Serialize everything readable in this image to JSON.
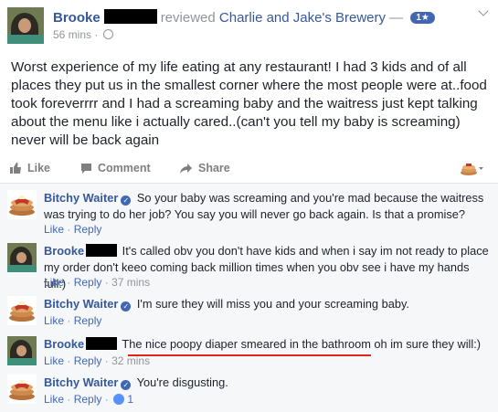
{
  "post": {
    "author": "Brooke",
    "verb": "reviewed",
    "page": "Charlie and Jake's Brewery",
    "dash": "—",
    "rating_badge": "1★",
    "time": "56 mins",
    "separator": "·",
    "body": "Worst experience of my life eating at any restaurant! I had 3 kids and of all places they put us in the smallest corner where the most people were at..food took foreverrrr and I had a screaming baby and the waitress just kept talking about the menu like i actually cared..(can't you tell my baby is screaming) never will be back again"
  },
  "actions": {
    "like": "Like",
    "comment": "Comment",
    "share": "Share"
  },
  "comments": [
    {
      "author": "Bitchy Waiter",
      "text": "So your baby was screaming and you're mad because the waitress was trying to do her job? You say you will never go back again. Is that a promise?",
      "like": "Like",
      "reply": "Reply",
      "sep": "·"
    },
    {
      "author": "Brooke",
      "text": "It's called obv you don't have kids and when i say im not ready to place my order don't keeo coming back million times when you obv see i have my hands full:)",
      "like": "Like",
      "reply": "Reply",
      "sep": "·",
      "time": "37 mins"
    },
    {
      "author": "Bitchy Waiter",
      "text": "I'm sure they will miss you and your screaming baby.",
      "like": "Like",
      "reply": "Reply",
      "sep": "·"
    },
    {
      "author": "Brooke",
      "text": "The nice poopy diaper smeared in the bathroom oh im sure they will:)",
      "like": "Like",
      "reply": "Reply",
      "sep": "·",
      "time": "32 mins"
    },
    {
      "author": "Bitchy Waiter",
      "text": "You're disgusting.",
      "like": "Like",
      "reply": "Reply",
      "sep": "·",
      "likes": "1"
    }
  ],
  "colors": {
    "link_blue": "#365899",
    "accent_blue": "#4267b2",
    "muted_gray": "#90949c",
    "highlight_red": "#e0241d"
  }
}
